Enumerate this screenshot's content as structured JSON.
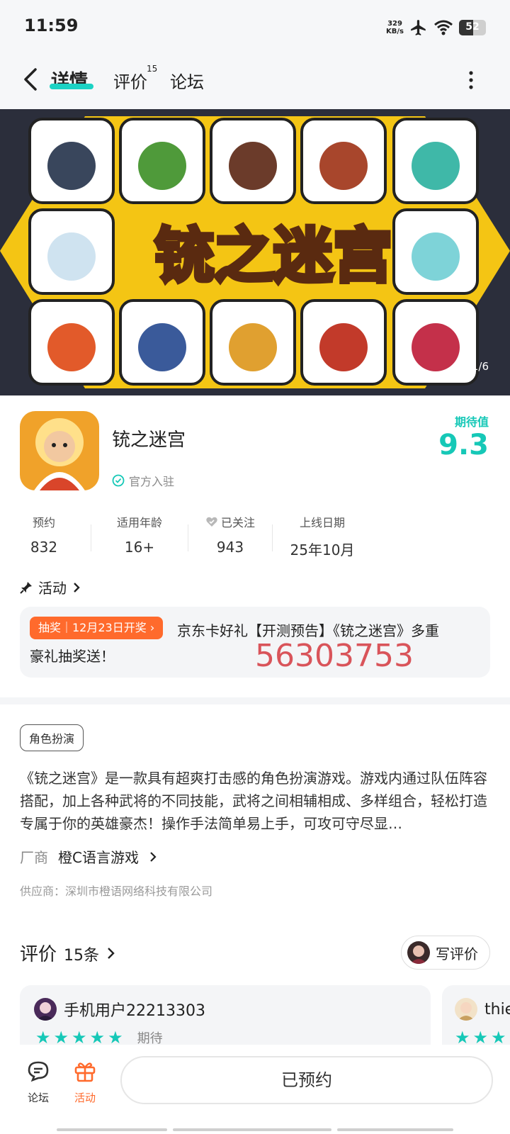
{
  "status_bar": {
    "time": "11:59",
    "speed_value": "329",
    "speed_unit": "KB/s",
    "battery": "52",
    "battery_level": 0.52
  },
  "nav": {
    "tabs": [
      {
        "label": "详情"
      },
      {
        "label": "评价"
      },
      {
        "label": "论坛"
      }
    ],
    "review_badge": "15"
  },
  "banner": {
    "indicator": "1/6",
    "title_art": "铳之迷宫"
  },
  "app": {
    "name": "铳之迷宫",
    "verified": "官方入驻",
    "expect_label": "期待值",
    "expect_score": "9.3",
    "stats": [
      {
        "label": "预约",
        "value": "832"
      },
      {
        "label": "适用年龄",
        "value": "16+"
      },
      {
        "label": "已关注",
        "value": "943"
      },
      {
        "label": "上线日期",
        "value": "25年10月"
      }
    ]
  },
  "activity": {
    "header": "活动",
    "tag": "抽奖｜12月23日开奖",
    "text_line1": "京东卡好礼【开测预告】《铳之迷宫》多重",
    "text_line2": "豪礼抽奖送！",
    "overlay_number": "56303753"
  },
  "detail": {
    "genre": "角色扮演",
    "description": "《铳之迷宫》是一款具有超爽打击感的角色扮演游戏。游戏内通过队伍阵容搭配，加上各种武将的不同技能，武将之间相辅相成、多样组合，轻松打造专属于你的英雄豪杰！操作手法简单易上手，可攻可守尽显…",
    "vendor_label": "厂商",
    "vendor_name": "橙C语言游戏",
    "supplier": "供应商：深圳市橙语网络科技有限公司"
  },
  "reviews": {
    "title": "评价",
    "count": "15条",
    "write_label": "写评价",
    "items": [
      {
        "user": "手机用户22213303",
        "tag": "期待"
      },
      {
        "user": "thie"
      }
    ]
  },
  "bottom_bar": {
    "forum": "论坛",
    "activity": "活动",
    "reserve": "已预约"
  },
  "colors": {
    "accent": "#16c8b7",
    "orange": "#ff6a2c",
    "number_red": "#d9545a"
  }
}
